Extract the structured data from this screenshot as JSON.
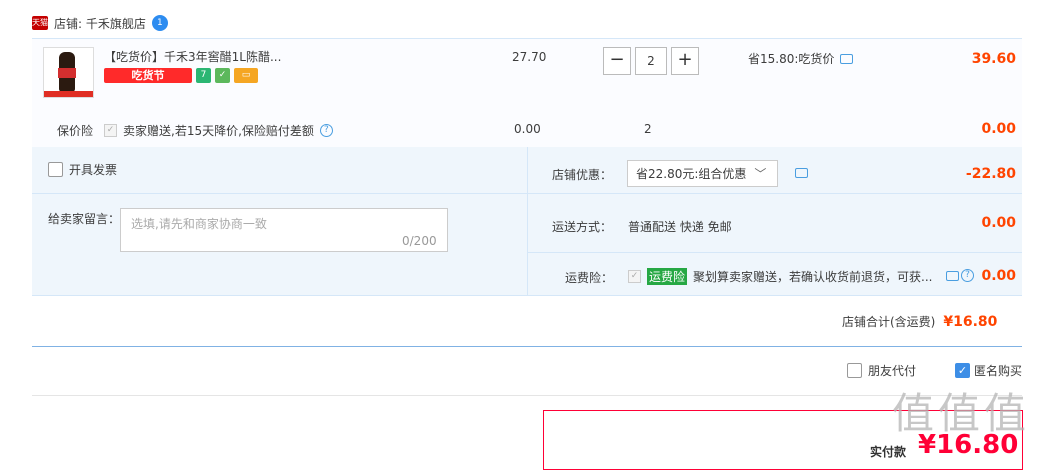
{
  "store": {
    "icon": "tmall-icon",
    "name": "店铺: 千禾旗舰店",
    "chat_icon": "wangwang-icon"
  },
  "item": {
    "title": "【吃货价】千禾3年窖醋1L陈醋...",
    "promo_badge": "吃货节",
    "unit_price": "27.70",
    "quantity": "2",
    "minus": "−",
    "plus": "+",
    "saving": "省15.80:吃货价",
    "total": "39.60"
  },
  "insurance": {
    "label": "保价险",
    "desc": "卖家赠送,若15天降价,保险赔付差额",
    "price": "0.00",
    "qty": "2",
    "total": "0.00"
  },
  "invoice": {
    "label": "开具发票"
  },
  "memo": {
    "label": "给卖家留言：",
    "placeholder": "选填,请先和商家协商一致",
    "count": "0/200"
  },
  "coupon": {
    "label": "店铺优惠：",
    "selected": "省22.80元:组合优惠",
    "value": "-22.80"
  },
  "shipping": {
    "label": "运送方式：",
    "method": "普通配送 快递 免邮",
    "value": "0.00"
  },
  "shipping_insurance": {
    "label": "运费险：",
    "tag": "运费险",
    "desc": "聚划算卖家赠送，若确认收货前退货，可获...",
    "value": "0.00"
  },
  "store_total": {
    "label": "店铺合计(含运费)",
    "value": "¥16.80"
  },
  "options": {
    "friend_pay": "朋友代付",
    "anonymous": "匿名购买",
    "anonymous_checked": true
  },
  "payment": {
    "label": "实付款",
    "amount": "¥16.80"
  },
  "watermark": "值值值"
}
